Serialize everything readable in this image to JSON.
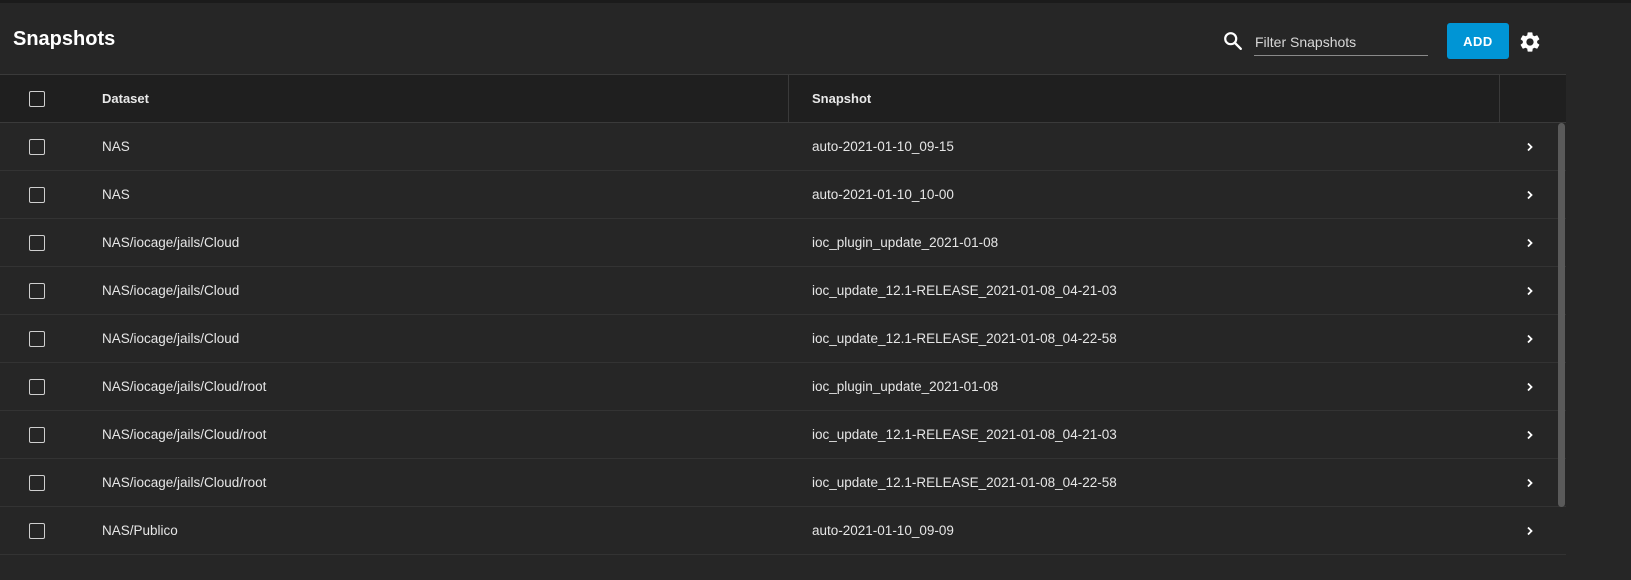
{
  "header": {
    "title": "Snapshots",
    "filter_placeholder": "Filter Snapshots",
    "add_label": "ADD"
  },
  "icons": {
    "search": "search-icon",
    "settings": "gear-icon",
    "row_expand": "chevron-right-icon"
  },
  "colors": {
    "accent": "#0095d5",
    "background": "#262626",
    "header_row": "#1f1f1f"
  },
  "table": {
    "columns": [
      "Dataset",
      "Snapshot"
    ],
    "rows": [
      {
        "dataset": "NAS",
        "snapshot": "auto-2021-01-10_09-15"
      },
      {
        "dataset": "NAS",
        "snapshot": "auto-2021-01-10_10-00"
      },
      {
        "dataset": "NAS/iocage/jails/Cloud",
        "snapshot": "ioc_plugin_update_2021-01-08"
      },
      {
        "dataset": "NAS/iocage/jails/Cloud",
        "snapshot": "ioc_update_12.1-RELEASE_2021-01-08_04-21-03"
      },
      {
        "dataset": "NAS/iocage/jails/Cloud",
        "snapshot": "ioc_update_12.1-RELEASE_2021-01-08_04-22-58"
      },
      {
        "dataset": "NAS/iocage/jails/Cloud/root",
        "snapshot": "ioc_plugin_update_2021-01-08"
      },
      {
        "dataset": "NAS/iocage/jails/Cloud/root",
        "snapshot": "ioc_update_12.1-RELEASE_2021-01-08_04-21-03"
      },
      {
        "dataset": "NAS/iocage/jails/Cloud/root",
        "snapshot": "ioc_update_12.1-RELEASE_2021-01-08_04-22-58"
      },
      {
        "dataset": "NAS/Publico",
        "snapshot": "auto-2021-01-10_09-09"
      }
    ]
  }
}
